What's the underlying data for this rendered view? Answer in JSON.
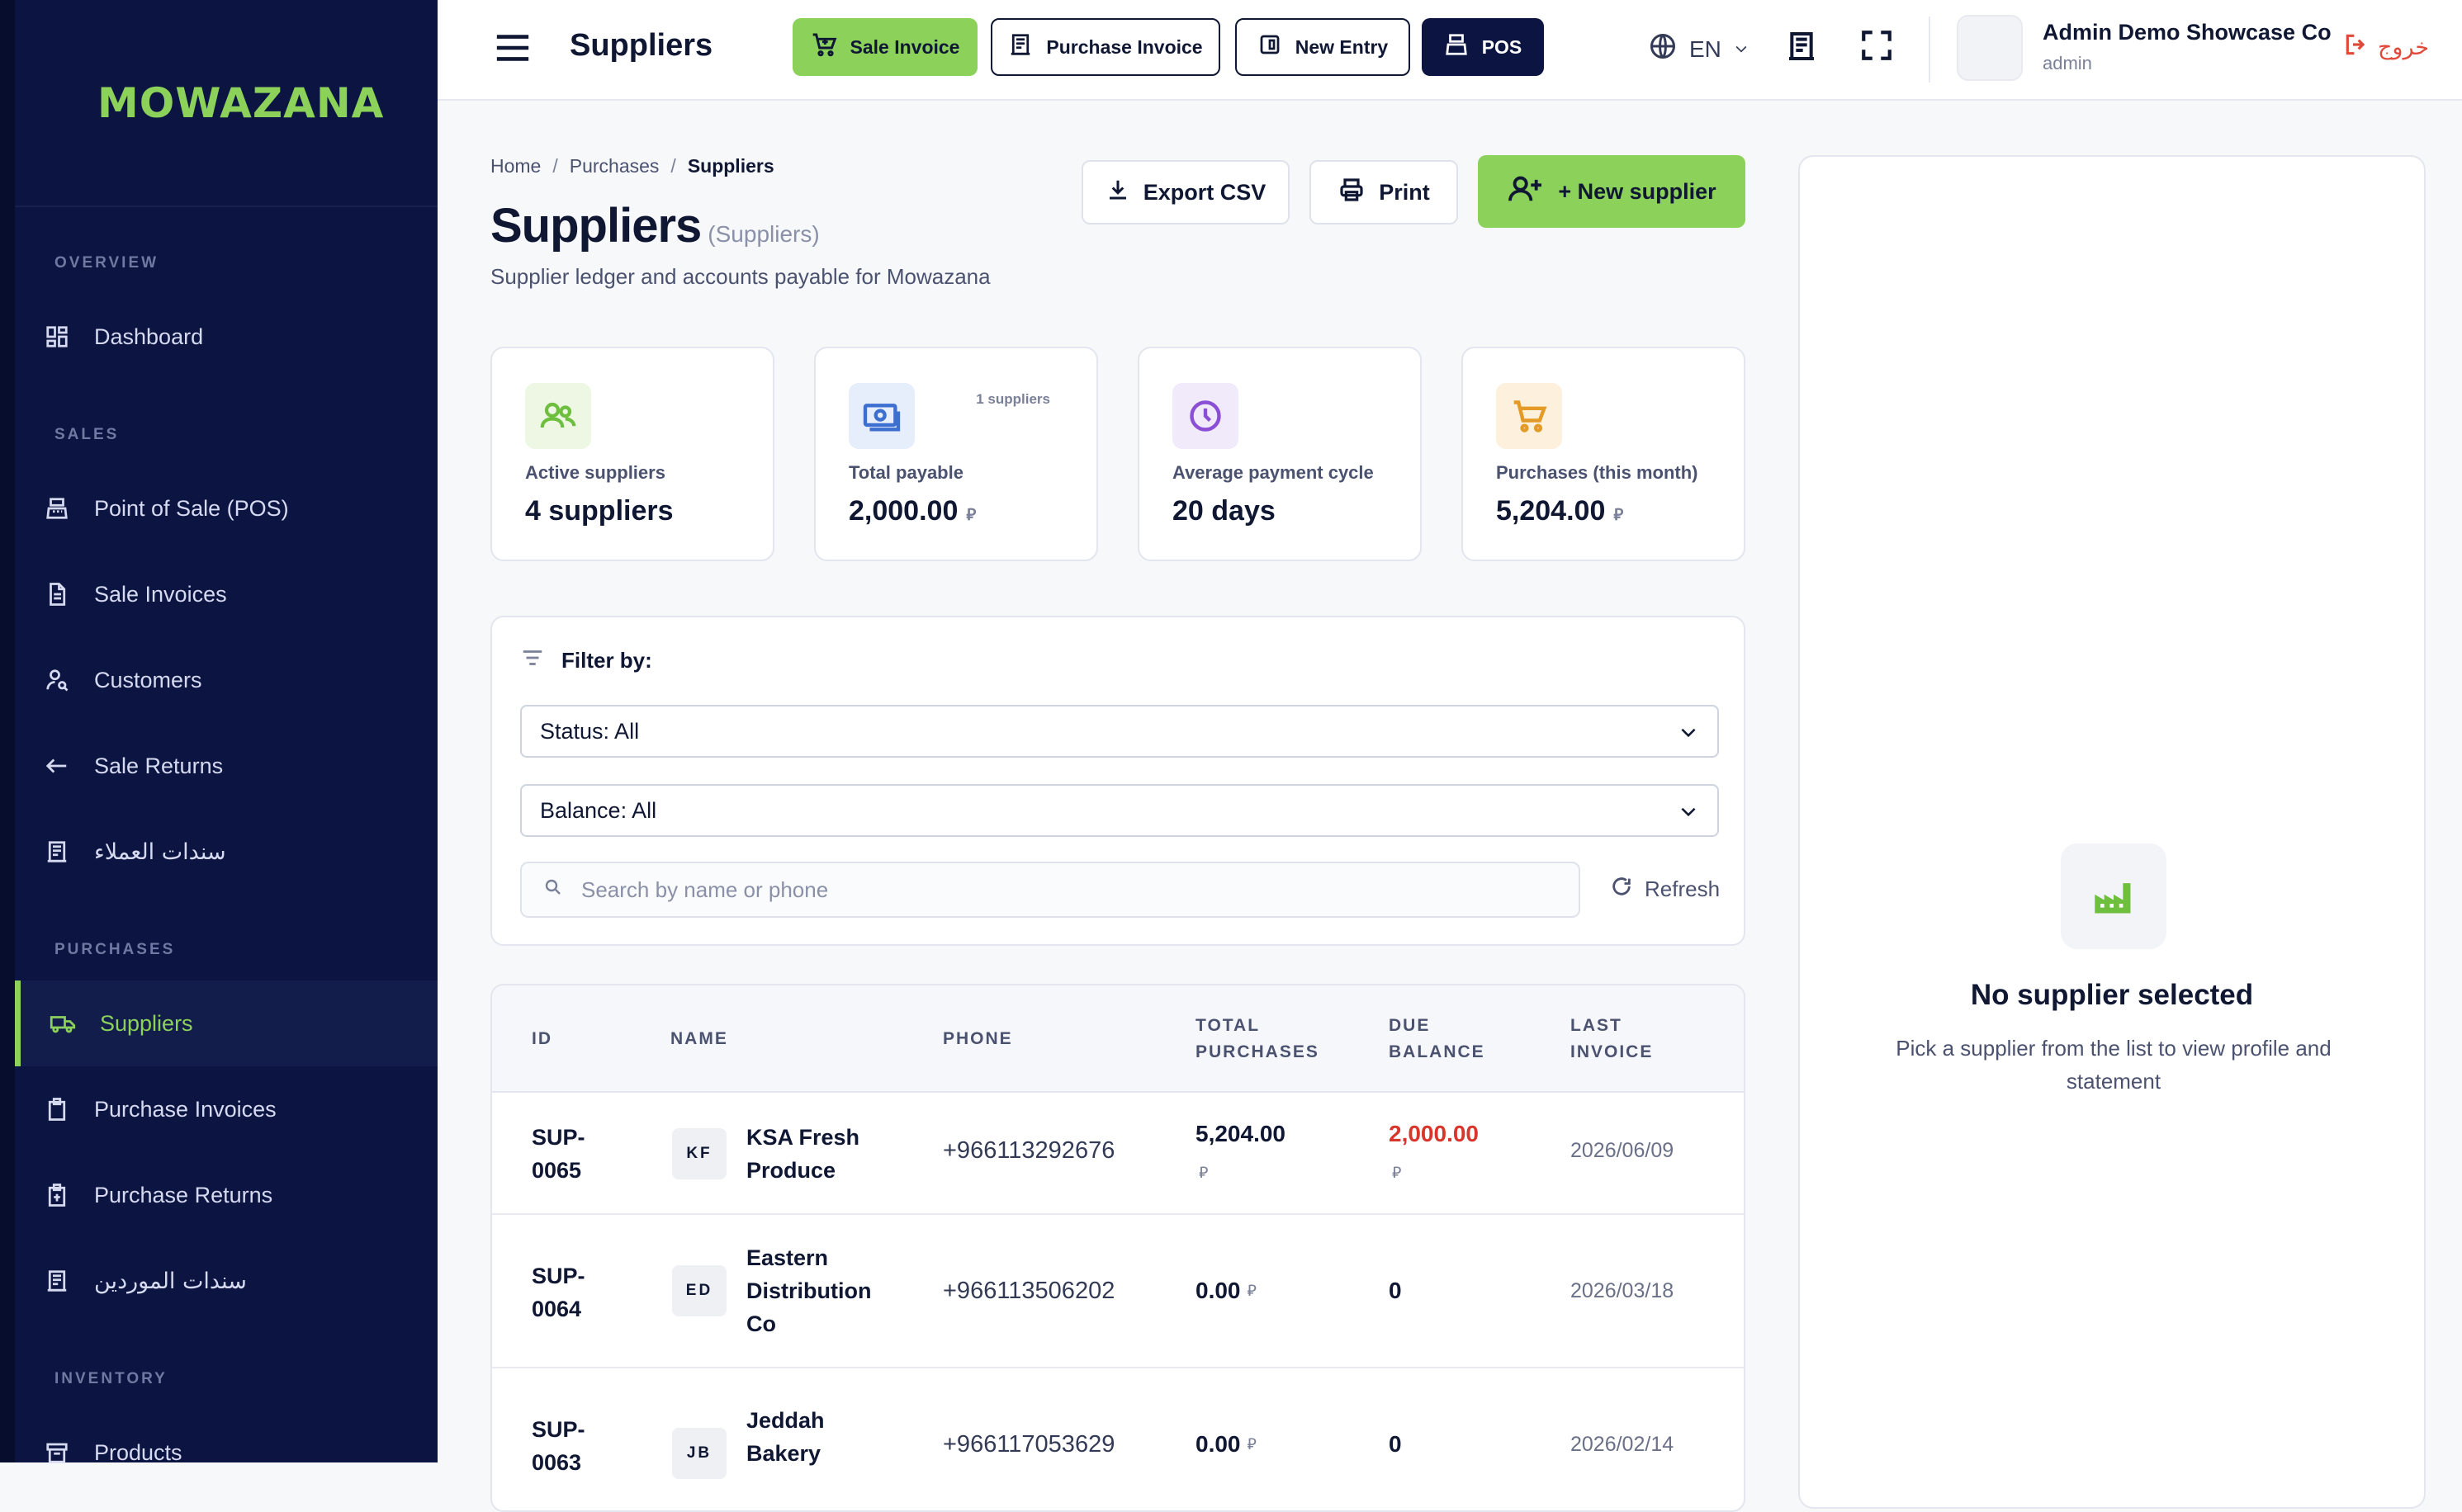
{
  "app": {
    "logo_text": "MOWAZANA"
  },
  "sidebar": {
    "sections": {
      "overview": "OVERVIEW",
      "sales": "SALES",
      "purchases": "PURCHASES",
      "inventory": "INVENTORY"
    },
    "items": [
      {
        "label": "Dashboard",
        "icon": "dashboard-icon"
      },
      {
        "label": "Point of Sale (POS)",
        "icon": "pos-icon"
      },
      {
        "label": "Sale Invoices",
        "icon": "document-icon"
      },
      {
        "label": "Customers",
        "icon": "user-search-icon"
      },
      {
        "label": "Sale Returns",
        "icon": "return-arrow-icon"
      },
      {
        "label": "سندات العملاء",
        "icon": "receipt-icon"
      },
      {
        "label": "Suppliers",
        "icon": "truck-icon",
        "active": true
      },
      {
        "label": "Purchase Invoices",
        "icon": "clipboard-icon"
      },
      {
        "label": "Purchase Returns",
        "icon": "return-box-icon"
      },
      {
        "label": "سندات الموردين",
        "icon": "receipt-icon"
      },
      {
        "label": "Products",
        "icon": "box-icon"
      }
    ]
  },
  "topbar": {
    "title": "Suppliers",
    "buttons": {
      "sale_invoice": "Sale Invoice",
      "purchase_invoice": "Purchase Invoice",
      "new_entry": "New Entry",
      "pos": "POS"
    },
    "language": "EN",
    "user_name": "Admin Demo Showcase Co",
    "user_role": "admin",
    "logout": "خروج"
  },
  "page": {
    "breadcrumb": [
      "Home",
      "Purchases",
      "Suppliers"
    ],
    "title": "Suppliers",
    "title_sub": "(Suppliers)",
    "description": "Supplier ledger and accounts payable for Mowazana",
    "actions": {
      "export": "Export CSV",
      "print": "Print",
      "new_supplier": "+ New supplier"
    }
  },
  "stats": [
    {
      "label": "Active suppliers",
      "value": "4 suppliers",
      "currency": "",
      "badge": ""
    },
    {
      "label": "Total payable",
      "value": "2,000.00",
      "currency": "⃁",
      "badge": "1 suppliers"
    },
    {
      "label": "Average payment cycle",
      "value": "20 days",
      "currency": "",
      "badge": ""
    },
    {
      "label": "Purchases (this month)",
      "value": "5,204.00",
      "currency": "⃁",
      "badge": ""
    }
  ],
  "filters": {
    "heading": "Filter by:",
    "status": "Status: All",
    "balance": "Balance: All",
    "search_placeholder": "Search by name or phone",
    "refresh": "Refresh"
  },
  "table": {
    "headers": {
      "id": "ID",
      "name": "NAME",
      "phone": "PHONE",
      "total_purchases_1": "TOTAL",
      "total_purchases_2": "PURCHASES",
      "due_balance_1": "DUE",
      "due_balance_2": "BALANCE",
      "last_invoice_1": "LAST",
      "last_invoice_2": "INVOICE"
    },
    "rows": [
      {
        "id_1": "SUP-",
        "id_2": "0065",
        "initials": "KF",
        "name_1": "KSA Fresh",
        "name_2": "Produce",
        "name_3": "",
        "phone": "+966113292676",
        "total": "5,204.00",
        "total_cur": "⃁",
        "due": "2,000.00",
        "due_cur": "⃁",
        "last": "2026/06/09"
      },
      {
        "id_1": "SUP-",
        "id_2": "0064",
        "initials": "ED",
        "name_1": "Eastern",
        "name_2": "Distribution",
        "name_3": "Co",
        "phone": "+966113506202",
        "total": "0.00",
        "total_cur": "⃁",
        "due": "0",
        "due_cur": "",
        "last": "2026/03/18"
      },
      {
        "id_1": "SUP-",
        "id_2": "0063",
        "initials": "JB",
        "name_1": "Jeddah",
        "name_2": "Bakery",
        "name_3": "",
        "phone": "+966117053629",
        "total": "0.00",
        "total_cur": "⃁",
        "due": "0",
        "due_cur": "",
        "last": "2026/02/14"
      }
    ]
  },
  "detail": {
    "empty_title": "No supplier selected",
    "empty_desc": "Pick a supplier from the list to view profile and statement"
  },
  "colors": {
    "sidebar_bg": "#0c1541",
    "accent_green": "#8bd15a",
    "danger_red": "#d8352b"
  }
}
